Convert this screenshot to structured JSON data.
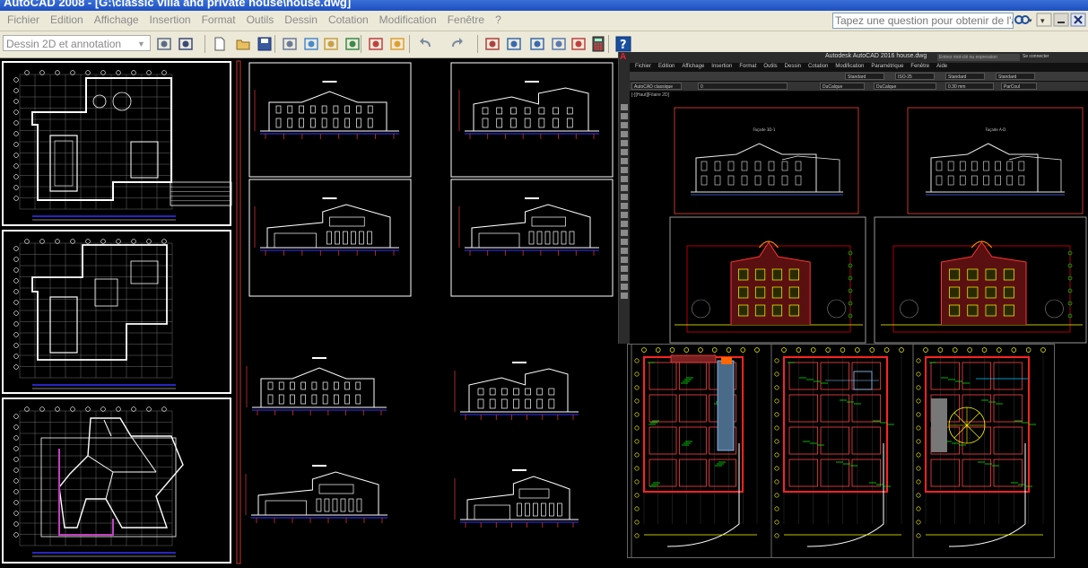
{
  "window": {
    "title": "AutoCAD 2008 - [G:\\classic villa and private house\\house.dwg]"
  },
  "menu": {
    "items": [
      "Fichier",
      "Edition",
      "Affichage",
      "Insertion",
      "Format",
      "Outils",
      "Dessin",
      "Cotation",
      "Modification",
      "Fenêtre",
      "?"
    ]
  },
  "help": {
    "placeholder": "Tapez une question pour obtenir de l'aide",
    "search_icon": "binoculars-icon",
    "close_icon": "close-icon"
  },
  "toolbar": {
    "workspace_value": "Dessin 2D et annotation",
    "buttons": [
      "workspace-settings-icon",
      "workspace-toolbar-icon",
      "new-icon",
      "open-icon",
      "save-icon",
      "plot-icon",
      "plot-preview-icon",
      "publish-icon",
      "3d-dwf-icon",
      "matchprop-icon",
      "block-editor-icon",
      "undo-icon",
      "redo-icon",
      "properties-icon",
      "design-center-icon",
      "tool-palettes-icon",
      "sheet-set-icon",
      "markup-icon",
      "quickcalc-icon",
      "help-icon"
    ]
  },
  "overlay": {
    "title": "Autodesk AutoCAD 2016   house.dwg",
    "search_placeholder": "Entrez mot-clé ou expression",
    "connect": "Se connecter",
    "menu": [
      "Fichier",
      "Edition",
      "Affichage",
      "Insertion",
      "Format",
      "Outils",
      "Dessin",
      "Cotation",
      "Modification",
      "Paramétrique",
      "Fenêtre",
      "Aide"
    ],
    "toolbar1": {
      "text_style": "Standard",
      "dim_style": "ISO-25",
      "table_style": "Standard",
      "mleader_style": "Standard"
    },
    "toolbar2": {
      "workspace": "AutoCAD classique",
      "layer": "0",
      "color": "DuCalque",
      "linetype": "DuCalque",
      "lineweight": "0.30 mm",
      "plotstyle": "ParCoul"
    },
    "tab": "[-][Haut][Filaire 2D]",
    "sheet_labels": [
      "Façade 3D-1",
      "Façade A-D"
    ]
  },
  "colors": {
    "title_bar": "#1d4fc0",
    "menu_bg": "#ece9d8",
    "canvas": "#000000",
    "sheet_red": "#c0392b"
  }
}
